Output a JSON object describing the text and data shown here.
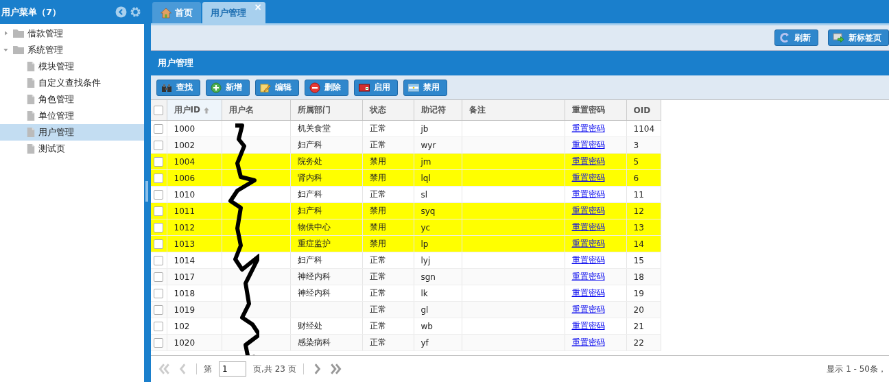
{
  "sidebar": {
    "title": "用户菜单（7）",
    "tree": [
      {
        "label": "借款管理",
        "expanded": false,
        "selected": false
      },
      {
        "label": "系统管理",
        "expanded": true,
        "selected": false,
        "children": [
          {
            "label": "模块管理",
            "selected": false
          },
          {
            "label": "自定义查找条件",
            "selected": false
          },
          {
            "label": "角色管理",
            "selected": false
          },
          {
            "label": "单位管理",
            "selected": false
          },
          {
            "label": "用户管理",
            "selected": true
          },
          {
            "label": "测试页",
            "selected": false
          }
        ]
      }
    ]
  },
  "tabs": [
    {
      "label": "首页",
      "kind": "home",
      "selected": false
    },
    {
      "label": "用户管理",
      "kind": "closable",
      "close": "×",
      "selected": true
    }
  ],
  "top_toolbar": [
    "刷新",
    "新标签页"
  ],
  "panel": {
    "title": "用户管理",
    "buttons": [
      {
        "label": "查找",
        "kind": "find"
      },
      {
        "label": "新增",
        "kind": "add"
      },
      {
        "label": "编辑",
        "kind": "edit"
      },
      {
        "label": "删除",
        "kind": "delete"
      },
      {
        "label": "启用",
        "kind": "enable"
      },
      {
        "label": "禁用",
        "kind": "disable"
      }
    ],
    "table": {
      "select_all_checked": false,
      "columns": [
        {
          "label": "用户ID",
          "sorted": true
        },
        {
          "label": "用户名",
          "sorted": false
        },
        {
          "label": "所属部门",
          "sorted": false
        },
        {
          "label": "状态",
          "sorted": false
        },
        {
          "label": "助记符",
          "sorted": false
        },
        {
          "label": "备注",
          "sorted": false
        },
        {
          "label": "重置密码",
          "sorted": false
        },
        {
          "label": "OID",
          "sorted": false
        }
      ],
      "rows": [
        {
          "id": "1000",
          "department": "机关食堂",
          "status": "正常",
          "mnemonic": "jb",
          "reset": "重置密码",
          "oid": "1104",
          "disabled": false
        },
        {
          "id": "1002",
          "department": "妇产科",
          "status": "正常",
          "mnemonic": "wyr",
          "reset": "重置密码",
          "oid": "3",
          "disabled": false
        },
        {
          "id": "1004",
          "department": "院务处",
          "status": "禁用",
          "mnemonic": "jm",
          "reset": "重置密码",
          "oid": "5",
          "disabled": true
        },
        {
          "id": "1006",
          "department": "肾内科",
          "status": "禁用",
          "mnemonic": "lql",
          "reset": "重置密码",
          "oid": "6",
          "disabled": true
        },
        {
          "id": "1010",
          "department": "妇产科",
          "status": "正常",
          "mnemonic": "sl",
          "reset": "重置密码",
          "oid": "11",
          "disabled": false
        },
        {
          "id": "1011",
          "department": "妇产科",
          "status": "禁用",
          "mnemonic": "syq",
          "reset": "重置密码",
          "oid": "12",
          "disabled": true
        },
        {
          "id": "1012",
          "department": "物供中心",
          "status": "禁用",
          "mnemonic": "yc",
          "reset": "重置密码",
          "oid": "13",
          "disabled": true
        },
        {
          "id": "1013",
          "department": "重症监护",
          "status": "禁用",
          "mnemonic": "lp",
          "reset": "重置密码",
          "oid": "14",
          "disabled": true
        },
        {
          "id": "1014",
          "department": "妇产科",
          "status": "正常",
          "mnemonic": "lyj",
          "reset": "重置密码",
          "oid": "15",
          "disabled": false
        },
        {
          "id": "1017",
          "department": "神经内科",
          "status": "正常",
          "mnemonic": "sgn",
          "reset": "重置密码",
          "oid": "18",
          "disabled": false
        },
        {
          "id": "1018",
          "department": "神经内科",
          "status": "正常",
          "mnemonic": "lk",
          "reset": "重置密码",
          "oid": "19",
          "disabled": false
        },
        {
          "id": "1019",
          "status": "正常",
          "mnemonic": "gl",
          "reset": "重置密码",
          "oid": "20",
          "disabled": false
        },
        {
          "id": "102",
          "department": "财经处",
          "status": "正常",
          "mnemonic": "wb",
          "reset": "重置密码",
          "oid": "21",
          "disabled": false
        },
        {
          "id": "1020",
          "department": "感染病科",
          "status": "正常",
          "mnemonic": "yf",
          "reset": "重置密码",
          "oid": "22",
          "disabled": false
        }
      ]
    },
    "pager": {
      "before": "第",
      "page": "1",
      "after": "页,共 23 页",
      "summary": "显示 1 - 50条，"
    }
  }
}
